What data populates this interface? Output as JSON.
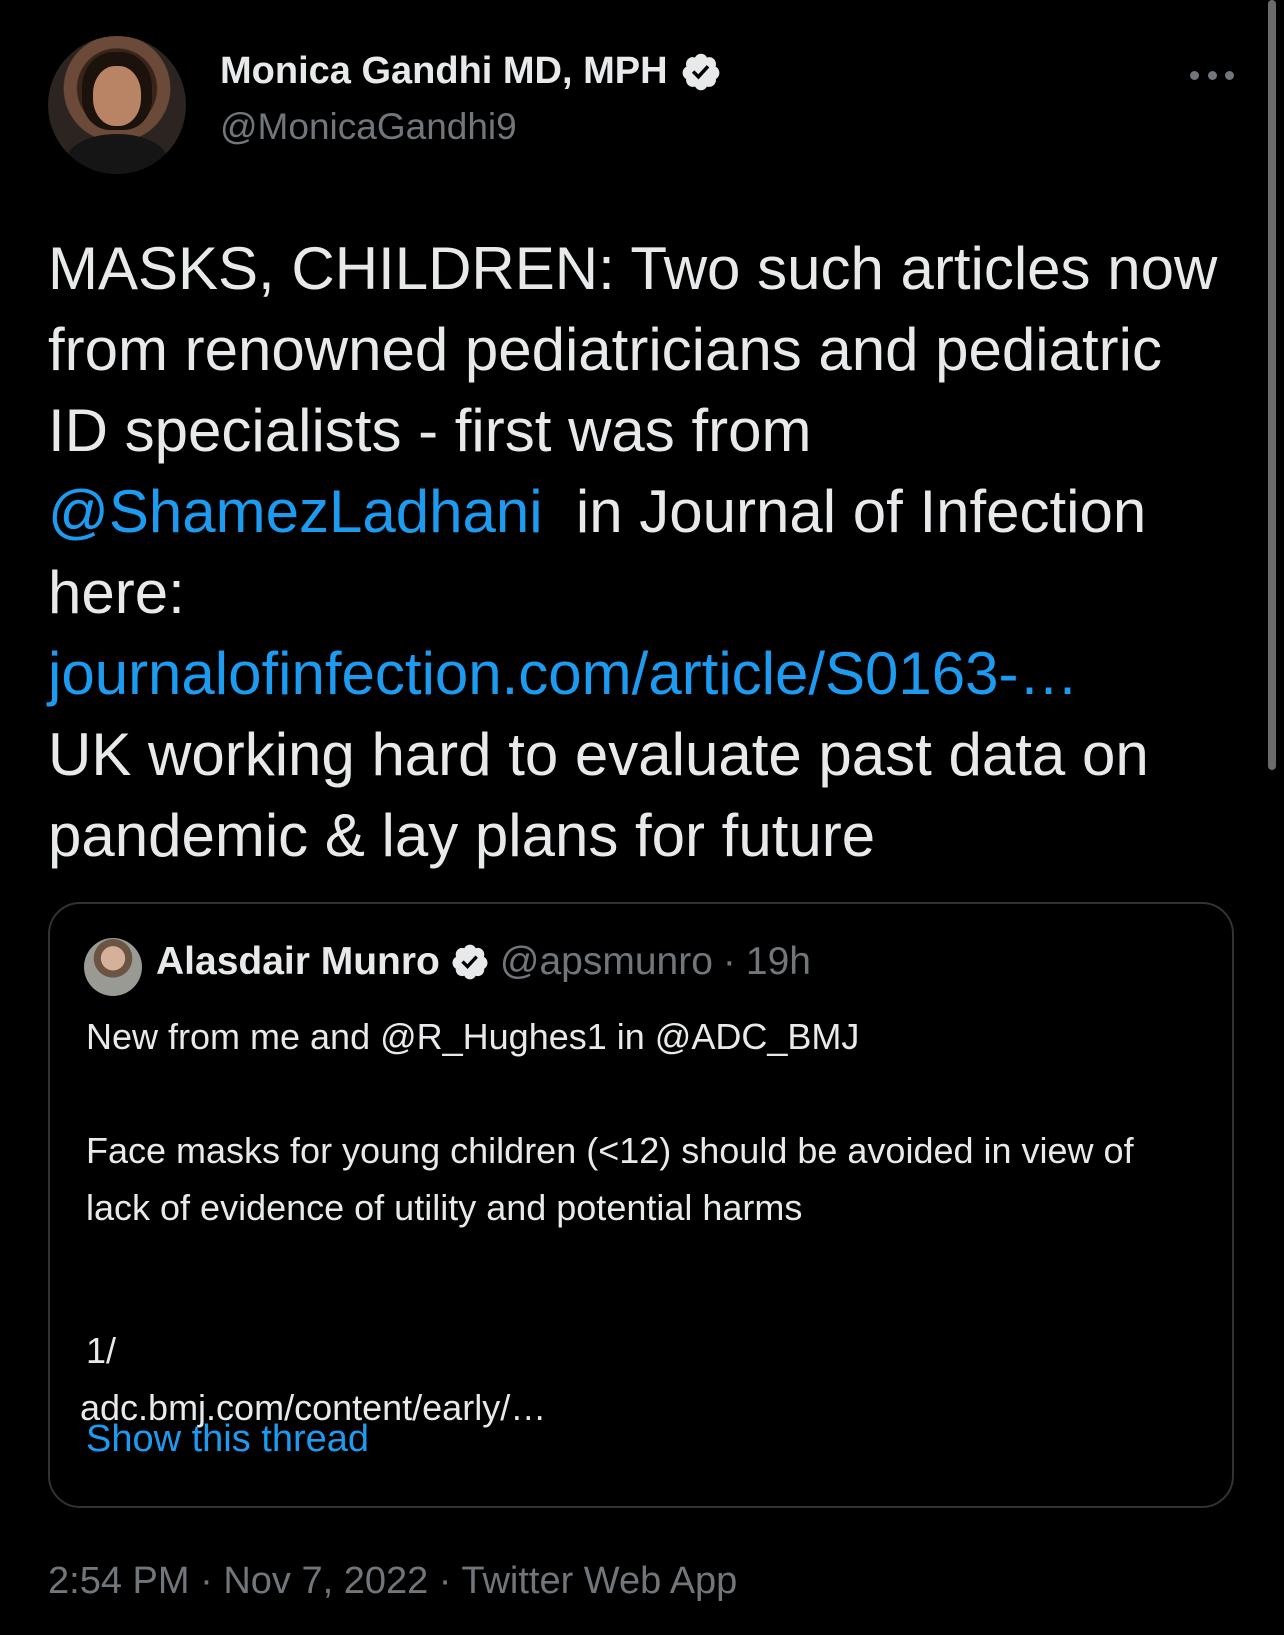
{
  "tweet": {
    "author_name": "Monica Gandhi MD, MPH",
    "author_handle": "@MonicaGandhi9",
    "text_part1": "MASKS, CHILDREN: Two such articles now from renowned pediatricians and pediatric ID specialists - first was from ",
    "mention": "@ShamezLadhani",
    "text_part2": "  in Journal of Infection here:",
    "link": "journalofinfection.com/article/S0163-…",
    "text_part3": "UK working hard to evaluate past data on pandemic & lay plans for future",
    "time": "2:54 PM",
    "date": "Nov 7, 2022",
    "source": "Twitter Web App",
    "separator": "·"
  },
  "quote": {
    "author_name": "Alasdair Munro",
    "author_handle": "@apsmunro",
    "separator": "·",
    "time": "19h",
    "line1": "New from me and @R_Hughes1 in @ADC_BMJ",
    "line2": "Face masks for young children (<12) should be avoided in view of lack of evidence of utility and potential harms",
    "line3": "1/",
    "line4": "adc.bmj.com/content/early/…",
    "show_thread": "Show this thread"
  },
  "colors": {
    "background": "#000000",
    "text": "#e7e9ea",
    "secondary": "#71767b",
    "link": "#1d9bf0",
    "border": "#2f3336"
  },
  "icons": [
    "verified-badge-icon",
    "more-options-icon"
  ]
}
